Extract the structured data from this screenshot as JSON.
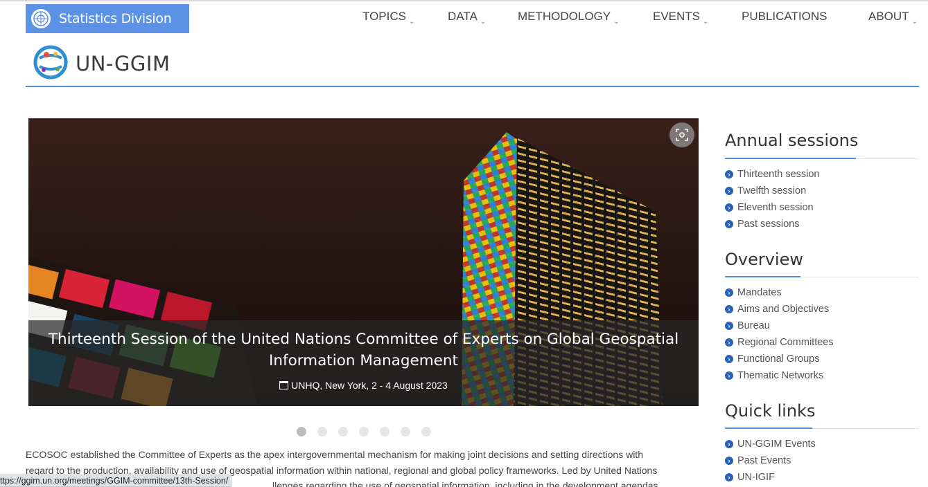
{
  "brand": {
    "label": "Statistics Division",
    "color": "#5b92e5"
  },
  "nav": [
    {
      "label": "TOPICS",
      "dropdown": true
    },
    {
      "label": "DATA",
      "dropdown": true
    },
    {
      "label": "METHODOLOGY",
      "dropdown": true
    },
    {
      "label": "EVENTS",
      "dropdown": true
    },
    {
      "label": "PUBLICATIONS",
      "dropdown": false
    },
    {
      "label": "ABOUT",
      "dropdown": true
    }
  ],
  "logo": {
    "text": "UN-GGIM",
    "icon": "globe-icon"
  },
  "carousel": {
    "title": "Thirteenth Session of the United Nations Committee of Experts on Global Geospatial Information Management",
    "subtitle": "UNHQ, New York, 2 - 4 August 2023",
    "slide_count": 7,
    "active_slide": 1
  },
  "intro": {
    "line1": "ECOSOC established the Committee of Experts as the apex intergovernmental mechanism for making joint decisions and setting directions with",
    "line2": "regard to the production, availability and use of geospatial information within national, regional and global policy frameworks. Led by United Nations",
    "line3": "llenges regarding the use of geospatial information, including in the development agendas"
  },
  "status_bar": {
    "url": "ttps://ggim.un.org/meetings/GGIM-committee/13th-Session/"
  },
  "sidebar": {
    "annual": {
      "title": "Annual sessions",
      "items": [
        "Thirteenth session",
        "Twelfth session",
        "Eleventh session",
        "Past sessions"
      ]
    },
    "overview": {
      "title": "Overview",
      "items": [
        "Mandates",
        "Aims and Objectives",
        "Bureau",
        "Regional Committees",
        "Functional Groups",
        "Thematic Networks"
      ]
    },
    "quick": {
      "title": "Quick links",
      "items": [
        "UN-GGIM Events",
        "Past Events",
        "UN-IGIF"
      ]
    }
  },
  "accent_color": "#4f8fd8",
  "link_bullet_color": "#2b63b8"
}
